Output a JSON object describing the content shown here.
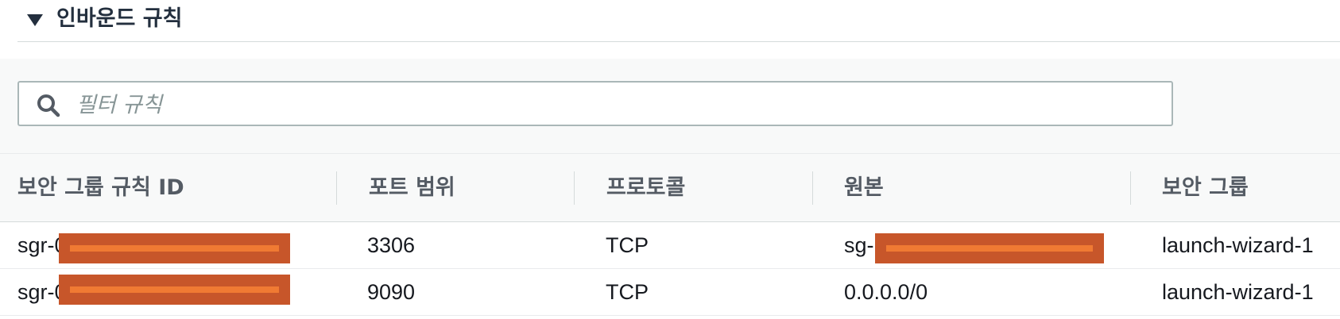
{
  "section": {
    "title": "인바운드 규칙",
    "expanded_icon": "caret-down-icon"
  },
  "filter": {
    "placeholder": "필터 규칙",
    "value": "",
    "icon": "search-icon"
  },
  "table": {
    "columns": [
      "보안 그룹 규칙 ID",
      "포트 범위",
      "프로토콜",
      "원본",
      "보안 그룹"
    ],
    "rows": [
      {
        "rule_id": "sgr-0",
        "port_range": "3306",
        "protocol": "TCP",
        "source": "sg-",
        "security_group": "launch-wizard-1"
      },
      {
        "rule_id": "sgr-0",
        "port_range": "9090",
        "protocol": "TCP",
        "source": "0.0.0.0/0",
        "security_group": "launch-wizard-1"
      }
    ]
  },
  "colors": {
    "redaction": "#c7562a",
    "redaction_stripe": "#f07a33",
    "header_text": "#545b64"
  }
}
